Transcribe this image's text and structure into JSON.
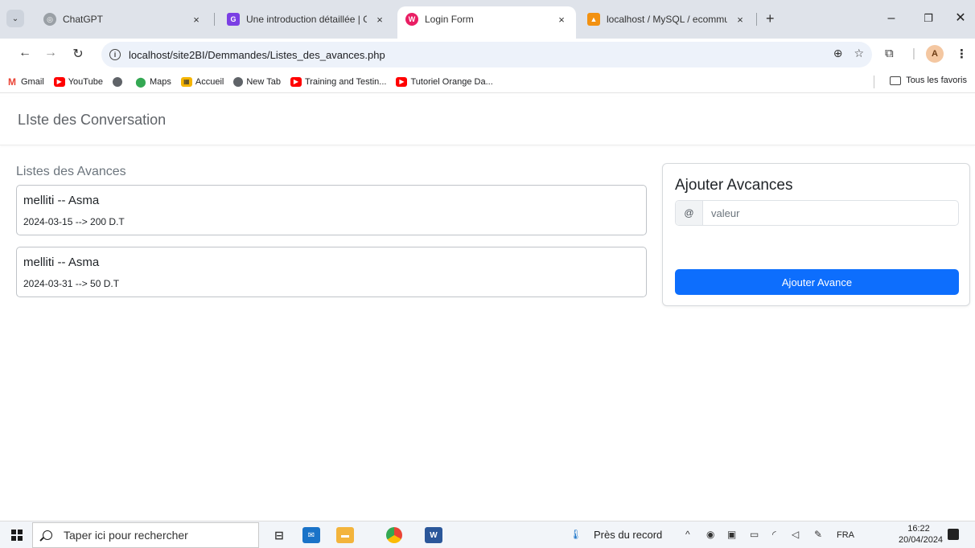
{
  "browser": {
    "tabs": [
      {
        "title": "ChatGPT",
        "favicon": "chatgpt-icon",
        "active": false
      },
      {
        "title": "Une introduction détaillée | Ga",
        "favicon": "gatsby-icon",
        "active": false
      },
      {
        "title": "Login Form",
        "favicon": "login-form-icon",
        "active": true
      },
      {
        "title": "localhost / MySQL / ecommun",
        "favicon": "phpmyadmin-icon",
        "active": false
      }
    ],
    "close_glyph": "×",
    "new_tab_glyph": "+",
    "address": "localhost/site2BI/Demmandes/Listes_des_avances.php",
    "bookmarks": [
      {
        "label": "Gmail",
        "icon": "gmail-icon"
      },
      {
        "label": "YouTube",
        "icon": "youtube-icon"
      },
      {
        "label": "",
        "icon": "globe-icon"
      },
      {
        "label": "Maps",
        "icon": "maps-icon"
      },
      {
        "label": "Accueil",
        "icon": "accueil-icon"
      },
      {
        "label": "New Tab",
        "icon": "globe-icon"
      },
      {
        "label": "Training and Testin...",
        "icon": "youtube-icon"
      },
      {
        "label": "Tutoriel Orange Da...",
        "icon": "youtube-icon"
      }
    ],
    "all_bookmarks": "Tous les favoris",
    "avatar_letter": "A"
  },
  "page": {
    "header_title": "LIste des Conversation",
    "list_heading": "Listes des Avances",
    "avances": [
      {
        "name": "melliti -- Asma",
        "detail": "2024-03-15 --> 200 D.T"
      },
      {
        "name": "melliti -- Asma",
        "detail": "2024-03-31 --> 50 D.T"
      }
    ],
    "form": {
      "title": "Ajouter Avcances",
      "addon": "@",
      "placeholder": "valeur",
      "value": "",
      "submit_label": "Ajouter Avance"
    }
  },
  "taskbar": {
    "search_placeholder": "Taper ici pour rechercher",
    "weather": "Près du record",
    "language": "FRA",
    "time": "16:22",
    "date": "20/04/2024"
  },
  "colors": {
    "primary": "#0d6efd",
    "tab_bg": "#dfe3ea",
    "omnibox_bg": "#edf2fa"
  }
}
